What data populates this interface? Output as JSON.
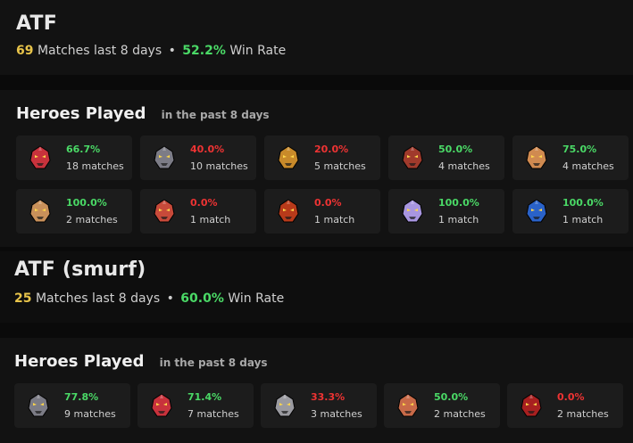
{
  "players": [
    {
      "name": "ATF",
      "matches_count": "69",
      "matches_label": "Matches last 8 days",
      "separator": "•",
      "win_rate": "52.2%",
      "win_rate_label": "Win Rate",
      "heroes_title": "Heroes Played",
      "heroes_subtitle": "in the past 8 days",
      "heroes": [
        {
          "win_rate": "66.7%",
          "matches": "18 matches",
          "result": "win",
          "icon": "hero-portrait-icon",
          "color": "#c8323c"
        },
        {
          "win_rate": "40.0%",
          "matches": "10 matches",
          "result": "loss",
          "icon": "hero-portrait-icon",
          "color": "#7c7c86"
        },
        {
          "win_rate": "20.0%",
          "matches": "5 matches",
          "result": "loss",
          "icon": "hero-portrait-icon",
          "color": "#c88a2a"
        },
        {
          "win_rate": "50.0%",
          "matches": "4 matches",
          "result": "win",
          "icon": "hero-portrait-icon",
          "color": "#a03a2c"
        },
        {
          "win_rate": "75.0%",
          "matches": "4 matches",
          "result": "win",
          "icon": "hero-portrait-icon",
          "color": "#d08a50"
        },
        {
          "win_rate": "100.0%",
          "matches": "2 matches",
          "result": "win",
          "icon": "hero-portrait-icon",
          "color": "#c8905a"
        },
        {
          "win_rate": "0.0%",
          "matches": "1 match",
          "result": "loss",
          "icon": "hero-portrait-icon",
          "color": "#c84a3a"
        },
        {
          "win_rate": "0.0%",
          "matches": "1 match",
          "result": "loss",
          "icon": "hero-portrait-icon",
          "color": "#b83a1a"
        },
        {
          "win_rate": "100.0%",
          "matches": "1 match",
          "result": "win",
          "icon": "hero-portrait-icon",
          "color": "#a896e0"
        },
        {
          "win_rate": "100.0%",
          "matches": "1 match",
          "result": "win",
          "icon": "hero-portrait-icon",
          "color": "#2a62c8"
        }
      ]
    },
    {
      "name": "ATF (smurf)",
      "matches_count": "25",
      "matches_label": "Matches last 8 days",
      "separator": "•",
      "win_rate": "60.0%",
      "win_rate_label": "Win Rate",
      "heroes_title": "Heroes Played",
      "heroes_subtitle": "in the past 8 days",
      "heroes": [
        {
          "win_rate": "77.8%",
          "matches": "9 matches",
          "result": "win",
          "icon": "hero-portrait-icon",
          "color": "#7c7c86"
        },
        {
          "win_rate": "71.4%",
          "matches": "7 matches",
          "result": "win",
          "icon": "hero-portrait-icon",
          "color": "#c8323c"
        },
        {
          "win_rate": "33.3%",
          "matches": "3 matches",
          "result": "loss",
          "icon": "hero-portrait-icon",
          "color": "#9a9aa0"
        },
        {
          "win_rate": "50.0%",
          "matches": "2 matches",
          "result": "win",
          "icon": "hero-portrait-icon",
          "color": "#c86a48"
        },
        {
          "win_rate": "0.0%",
          "matches": "2 matches",
          "result": "loss",
          "icon": "hero-portrait-icon",
          "color": "#a82020"
        }
      ]
    }
  ]
}
